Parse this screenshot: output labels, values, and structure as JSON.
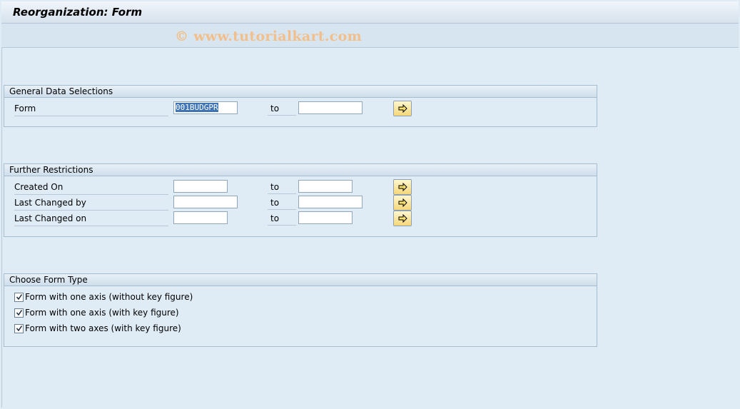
{
  "window": {
    "title": "Reorganization: Form"
  },
  "watermark": "© www.tutorialkart.com",
  "general": {
    "heading": "General Data Selections",
    "form_label": "Form",
    "form_from": "001BUDGPR",
    "to_label": "to",
    "form_to": ""
  },
  "restrictions": {
    "heading": "Further Restrictions",
    "rows": [
      {
        "label": "Created On",
        "to": "to"
      },
      {
        "label": "Last Changed by",
        "to": "to"
      },
      {
        "label": "Last Changed on",
        "to": "to"
      }
    ]
  },
  "form_type": {
    "heading": "Choose Form Type",
    "options": [
      {
        "label": "Form with one axis (without key figure)",
        "checked": true
      },
      {
        "label": "Form with one axis (with key figure)",
        "checked": true
      },
      {
        "label": "Form with two axes (with key figure)",
        "checked": true
      }
    ]
  },
  "colors": {
    "background": "#dfebf5",
    "button": "#f5d77a",
    "selection": "#3f74b5"
  },
  "icons": {
    "multiple_selection": "arrow-right-icon",
    "checkbox": "check-icon"
  }
}
